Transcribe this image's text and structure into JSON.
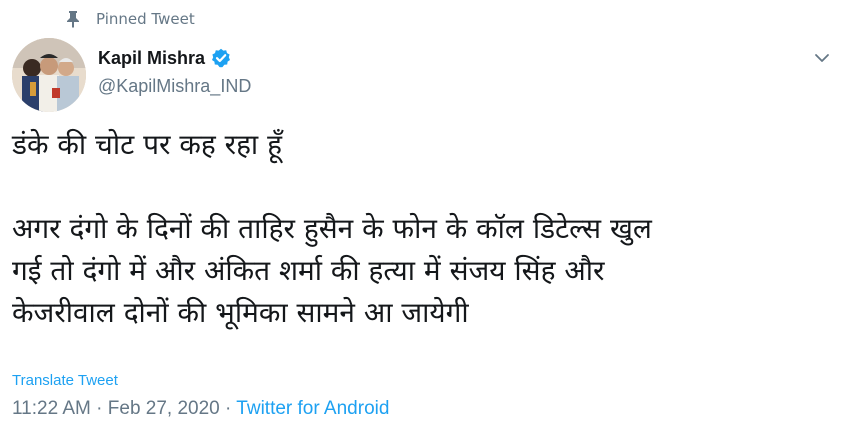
{
  "pinned": {
    "label": "Pinned Tweet",
    "icon": "pin-icon"
  },
  "author": {
    "name": "Kapil Mishra",
    "handle": "@KapilMishra_IND",
    "verified": true,
    "verified_color": "#1da1f2"
  },
  "tweet": {
    "lines": [
      "डंके की चोट पर कह रहा हूँ",
      "",
      "अगर दंगो के दिनों की ताहिर हुसैन के फोन के कॉल डिटेल्स खुल",
      "गई तो दंगो में और अंकित शर्मा की हत्या में संजय सिंह और",
      "केजरीवाल दोनों की  भूमिका सामने आ जायेगी"
    ]
  },
  "translate": {
    "label": "Translate Tweet"
  },
  "meta": {
    "time": "11:22 AM",
    "separator1": " · ",
    "date": "Feb 27, 2020",
    "separator2": " · ",
    "source": "Twitter for Android"
  },
  "colors": {
    "accent": "#1da1f2",
    "muted": "#657786",
    "text": "#14171a"
  }
}
